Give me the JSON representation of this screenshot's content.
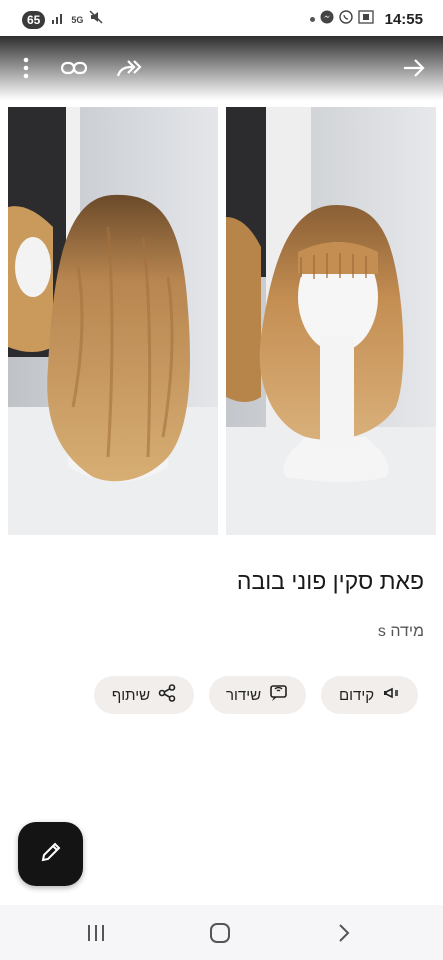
{
  "status_bar": {
    "badge": "65",
    "network": "5G",
    "time": "14:55"
  },
  "toolbar": {
    "icons": [
      "more-vert-icon",
      "link-icon",
      "share-forward-icon",
      "back-arrow-icon"
    ]
  },
  "product": {
    "title": "פאת סקין פוני בובה",
    "size_label": "מידה s"
  },
  "actions": [
    {
      "label": "קידום",
      "icon": "megaphone-icon"
    },
    {
      "label": "שידור",
      "icon": "broadcast-icon"
    },
    {
      "label": "שיתוף",
      "icon": "share-icon"
    }
  ],
  "fab": {
    "icon": "edit-pencil-icon"
  },
  "nav": {
    "icons": [
      "recents-icon",
      "home-icon",
      "back-icon"
    ]
  },
  "colors": {
    "chip_bg": "#f1eeec",
    "fab_bg": "#141414",
    "hair": "#c99a5b"
  }
}
